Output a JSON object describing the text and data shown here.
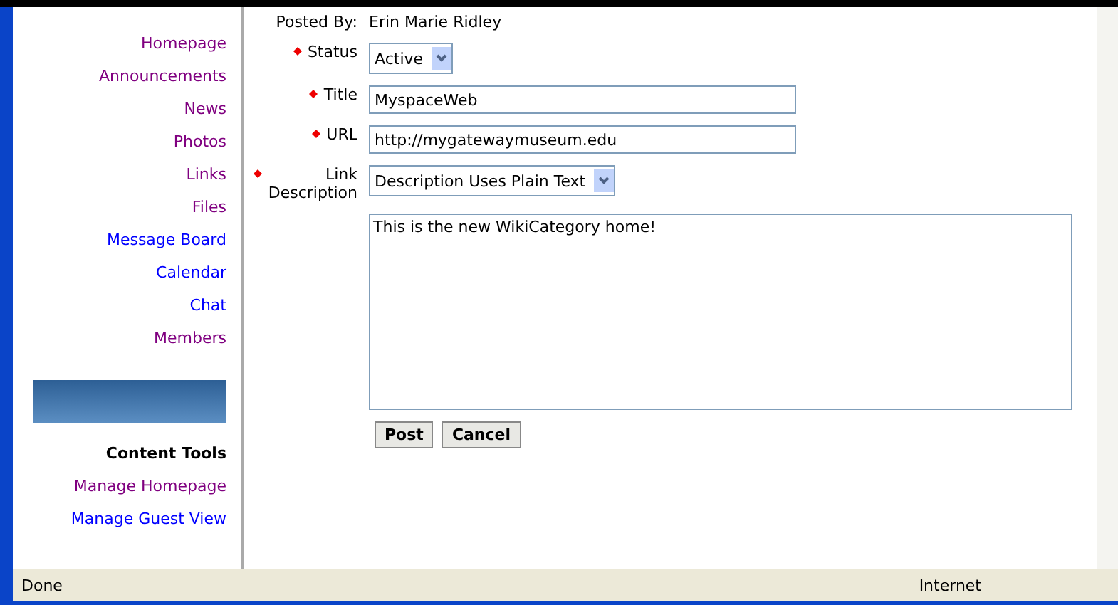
{
  "sidebar": {
    "items": [
      {
        "label": "Homepage",
        "visited": true
      },
      {
        "label": "Announcements",
        "visited": true
      },
      {
        "label": "News",
        "visited": true
      },
      {
        "label": "Photos",
        "visited": true
      },
      {
        "label": "Links",
        "visited": true
      },
      {
        "label": "Files",
        "visited": true
      },
      {
        "label": "Message Board",
        "visited": false
      },
      {
        "label": "Calendar",
        "visited": false
      },
      {
        "label": "Chat",
        "visited": false
      },
      {
        "label": "Members",
        "visited": true
      }
    ],
    "section_title": "Content Tools",
    "tools": [
      {
        "label": "Manage Homepage",
        "visited": true
      },
      {
        "label": "Manage Guest View",
        "visited": false
      }
    ]
  },
  "form": {
    "posted_by_label": "Posted By:",
    "posted_by": "Erin Marie Ridley",
    "fields": [
      {
        "kind": "select",
        "label": "Status",
        "value": "Active",
        "required": true
      },
      {
        "kind": "text",
        "label": "Title",
        "value": "MyspaceWeb",
        "required": true
      },
      {
        "kind": "text",
        "label": "URL",
        "value": "http://mygatewaymuseum.edu",
        "required": true
      },
      {
        "kind": "select",
        "label": "Link Description",
        "value": "Description Uses Plain Text",
        "required": true
      }
    ],
    "description": "This is the new WikiCategory home!",
    "buttons": [
      "Post",
      "Cancel"
    ]
  },
  "status_bar": {
    "left": "Done",
    "zone": "Internet"
  }
}
